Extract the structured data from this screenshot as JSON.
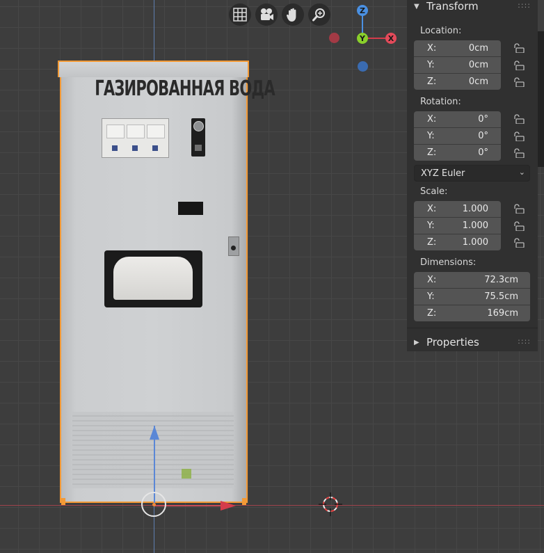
{
  "machine": {
    "title": "ГАЗИРОВАННАЯ ВОДА"
  },
  "nav_gizmo": {
    "buttons": [
      "grid-icon",
      "camera-icon",
      "hand-pan-icon",
      "zoom-icon"
    ],
    "axes": {
      "z": "Z",
      "y": "Y",
      "x": "X"
    }
  },
  "panel": {
    "transform_title": "Transform",
    "properties_title": "Properties",
    "location": {
      "label": "Location:",
      "rows": [
        {
          "axis": "X:",
          "value": "0cm"
        },
        {
          "axis": "Y:",
          "value": "0cm"
        },
        {
          "axis": "Z:",
          "value": "0cm"
        }
      ]
    },
    "rotation": {
      "label": "Rotation:",
      "rows": [
        {
          "axis": "X:",
          "value": "0°"
        },
        {
          "axis": "Y:",
          "value": "0°"
        },
        {
          "axis": "Z:",
          "value": "0°"
        }
      ],
      "mode": "XYZ Euler"
    },
    "scale": {
      "label": "Scale:",
      "rows": [
        {
          "axis": "X:",
          "value": "1.000"
        },
        {
          "axis": "Y:",
          "value": "1.000"
        },
        {
          "axis": "Z:",
          "value": "1.000"
        }
      ]
    },
    "dimensions": {
      "label": "Dimensions:",
      "rows": [
        {
          "axis": "X:",
          "value": "72.3cm"
        },
        {
          "axis": "Y:",
          "value": "75.5cm"
        },
        {
          "axis": "Z:",
          "value": "169cm"
        }
      ]
    }
  },
  "colors": {
    "selection_outline": "#f39a36",
    "x_axis": "#d43c4b",
    "y_axis": "#8ad02b",
    "z_axis": "#4a90e2"
  }
}
